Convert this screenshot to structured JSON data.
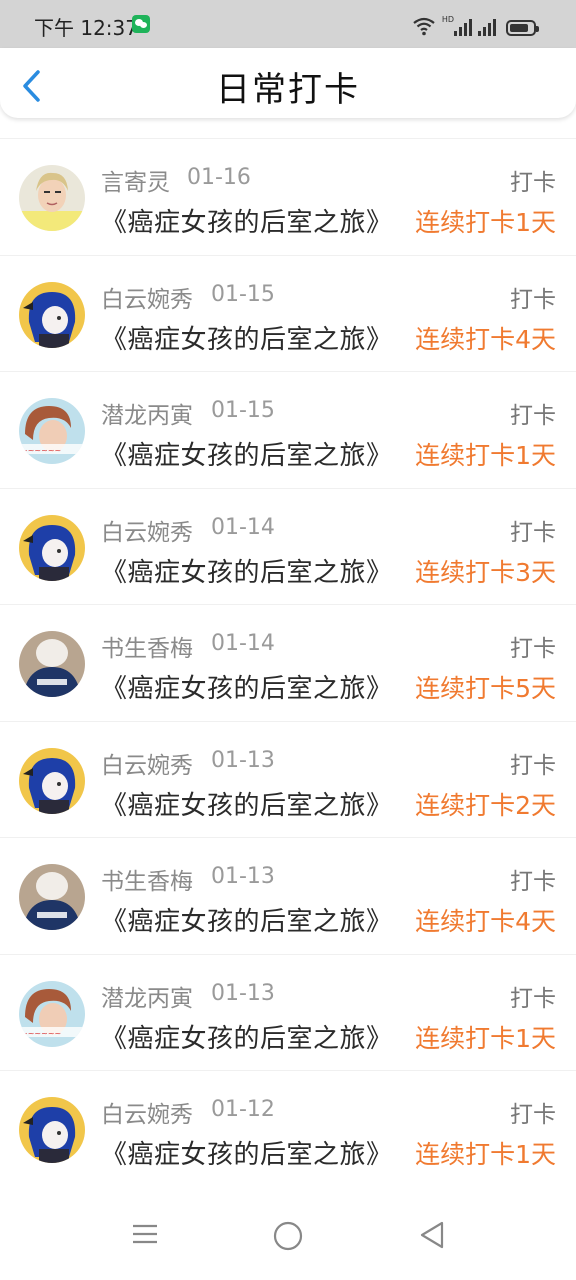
{
  "status_bar": {
    "time": "下午 12:37",
    "network_label": "HD"
  },
  "header": {
    "title": "日常打卡"
  },
  "records": [
    {
      "name": "言寄灵",
      "date": "01-16",
      "action": "打卡",
      "book": "《癌症女孩的后室之旅》",
      "streak": "连续打卡1天",
      "avatar": "blond-portrait"
    },
    {
      "name": "白云婉秀",
      "date": "01-15",
      "action": "打卡",
      "book": "《癌症女孩的后室之旅》",
      "streak": "连续打卡4天",
      "avatar": "anime-blue-hair"
    },
    {
      "name": "潜龙丙寅",
      "date": "01-15",
      "action": "打卡",
      "book": "《癌症女孩的后室之旅》",
      "streak": "连续打卡1天",
      "avatar": "red-hair-photo"
    },
    {
      "name": "白云婉秀",
      "date": "01-14",
      "action": "打卡",
      "book": "《癌症女孩的后室之旅》",
      "streak": "连续打卡3天",
      "avatar": "anime-blue-hair"
    },
    {
      "name": "书生香梅",
      "date": "01-14",
      "action": "打卡",
      "book": "《癌症女孩的后室之旅》",
      "streak": "连续打卡5天",
      "avatar": "cap-back-photo"
    },
    {
      "name": "白云婉秀",
      "date": "01-13",
      "action": "打卡",
      "book": "《癌症女孩的后室之旅》",
      "streak": "连续打卡2天",
      "avatar": "anime-blue-hair"
    },
    {
      "name": "书生香梅",
      "date": "01-13",
      "action": "打卡",
      "book": "《癌症女孩的后室之旅》",
      "streak": "连续打卡4天",
      "avatar": "cap-back-photo"
    },
    {
      "name": "潜龙丙寅",
      "date": "01-13",
      "action": "打卡",
      "book": "《癌症女孩的后室之旅》",
      "streak": "连续打卡1天",
      "avatar": "red-hair-photo"
    },
    {
      "name": "白云婉秀",
      "date": "01-12",
      "action": "打卡",
      "book": "《癌症女孩的后室之旅》",
      "streak": "连续打卡1天",
      "avatar": "anime-blue-hair"
    }
  ],
  "nav": {
    "menu_icon": "menu-icon",
    "home_icon": "home-circle-icon",
    "back_icon": "back-triangle-icon"
  },
  "colors": {
    "accent_blue": "#2a8ce0",
    "streak_orange": "#f07a30",
    "status_bar_bg": "#d4d4d4"
  }
}
